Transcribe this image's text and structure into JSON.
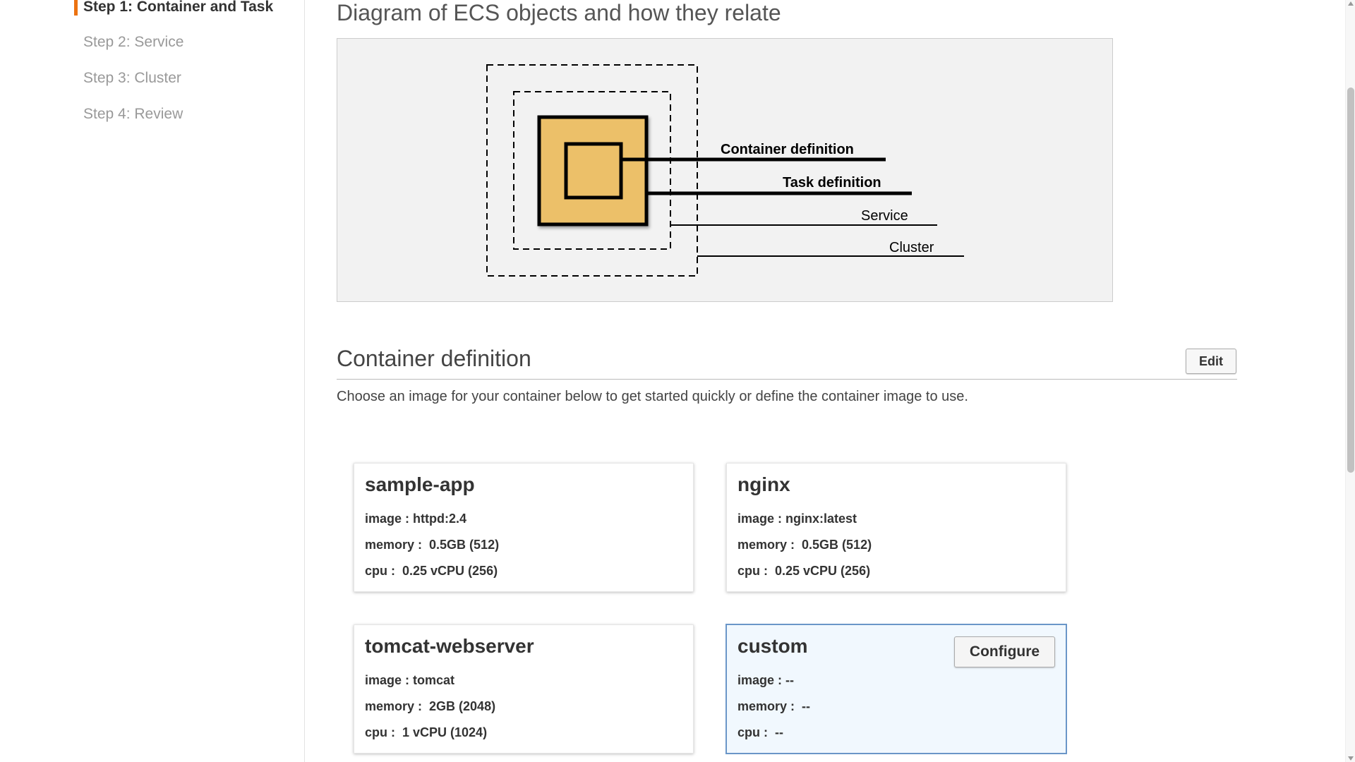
{
  "sidebar": {
    "steps": [
      {
        "label": "Step 1: Container and Task",
        "active": true
      },
      {
        "label": "Step 2: Service",
        "active": false
      },
      {
        "label": "Step 3: Cluster",
        "active": false
      },
      {
        "label": "Step 4: Review",
        "active": false
      }
    ]
  },
  "diagram": {
    "title": "Diagram of ECS objects and how they relate",
    "labels": {
      "container_definition": "Container definition",
      "task_definition": "Task definition",
      "service": "Service",
      "cluster": "Cluster"
    },
    "fill_color": "#ecc069"
  },
  "section": {
    "title": "Container definition",
    "edit_label": "Edit",
    "description": "Choose an image for your container below to get started quickly or define the container image to use."
  },
  "cards": [
    {
      "name": "sample-app",
      "image": "image : httpd:2.4",
      "memory": "memory :  0.5GB (512)",
      "cpu": "cpu :  0.25 vCPU (256)"
    },
    {
      "name": "nginx",
      "image": "image : nginx:latest",
      "memory": "memory :  0.5GB (512)",
      "cpu": "cpu :  0.25 vCPU (256)"
    },
    {
      "name": "tomcat-webserver",
      "image": "image : tomcat",
      "memory": "memory :  2GB (2048)",
      "cpu": "cpu :  1 vCPU (1024)"
    },
    {
      "name": "custom",
      "image": "image : --",
      "memory": "memory :  --",
      "cpu": "cpu :  --",
      "button_label": "Configure",
      "selected": true
    }
  ],
  "colors": {
    "accent": "#ec7211",
    "selected_border": "#6a96c8",
    "selected_bg": "#f1f8fe"
  }
}
